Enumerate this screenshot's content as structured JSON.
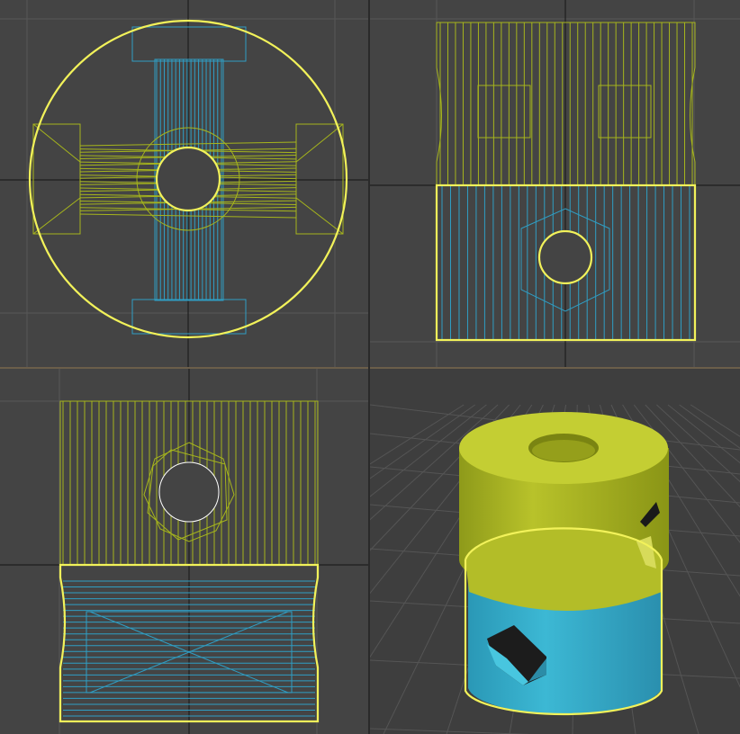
{
  "colors": {
    "viewport_bg": "#444444",
    "perspective_bg": "#3e3e3e",
    "grid_line": "#5a5a5a",
    "grid_axis": "#1e1e1e",
    "wire_yellow": "#a6b51c",
    "wire_cyan": "#2f9ec4",
    "selection_outline": "#f2f25a",
    "shaded_yellow": "#b8c22a",
    "shaded_cyan": "#3ab6d3",
    "active_divider": "#6b5e4a"
  },
  "viewports": [
    {
      "id": "top",
      "view": "orthographic-top",
      "active": false
    },
    {
      "id": "front",
      "view": "orthographic-front",
      "active": false
    },
    {
      "id": "left",
      "view": "orthographic-left",
      "active": false
    },
    {
      "id": "perspective",
      "view": "perspective-shaded",
      "active": true
    }
  ]
}
